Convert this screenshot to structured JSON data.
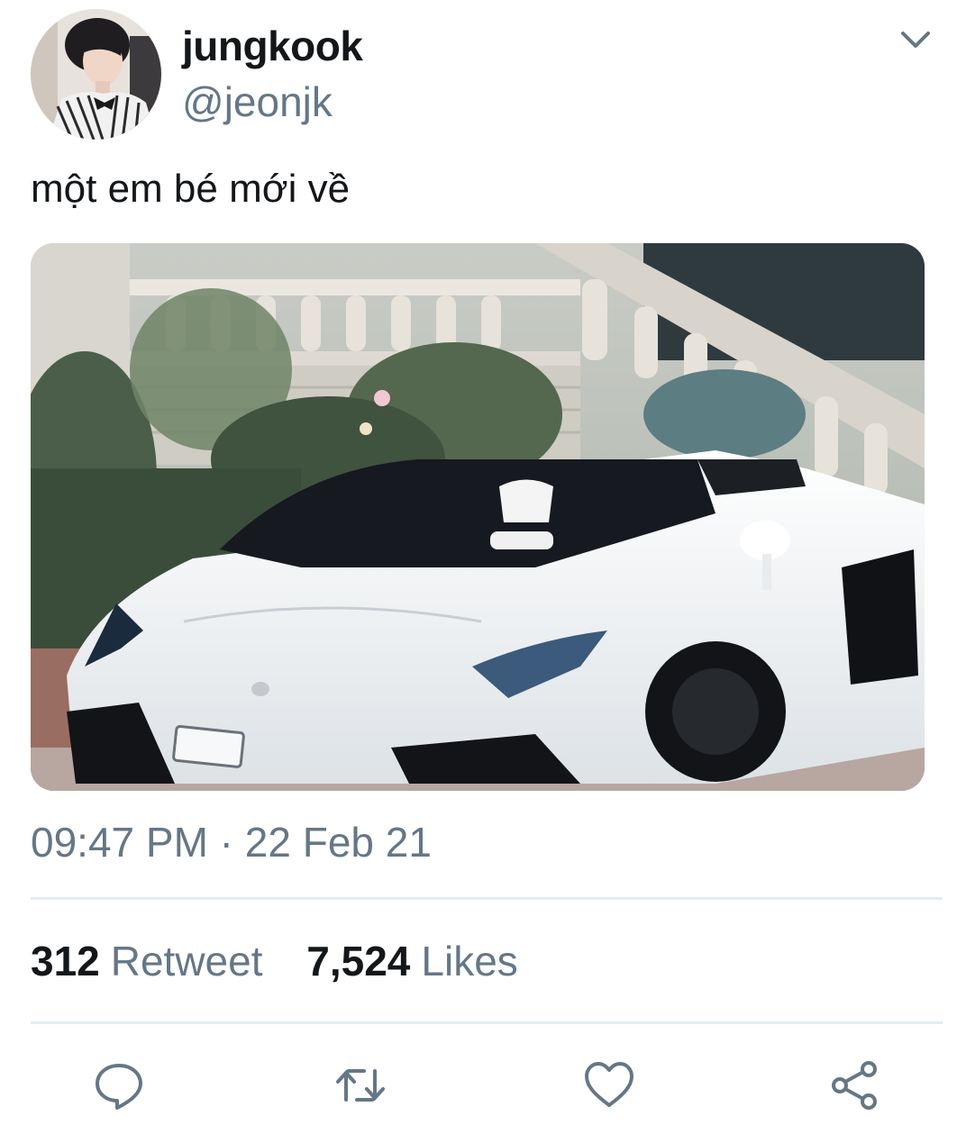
{
  "tweet": {
    "author": {
      "display_name": "jungkook",
      "handle": "@jeonjk"
    },
    "text": "một em bé mới về",
    "timestamp": "09:47 PM · 22 Feb 21",
    "stats": {
      "retweets_count": "312",
      "retweets_label": "Retweet",
      "likes_count": "7,524",
      "likes_label": "Likes"
    }
  },
  "icons": {
    "menu": "chevron-down-icon",
    "reply": "reply-icon",
    "retweet": "retweet-icon",
    "like": "heart-icon",
    "share": "share-icon"
  },
  "colors": {
    "primary_text": "#14171a",
    "secondary_text": "#657786",
    "divider": "#e6ecf0"
  }
}
